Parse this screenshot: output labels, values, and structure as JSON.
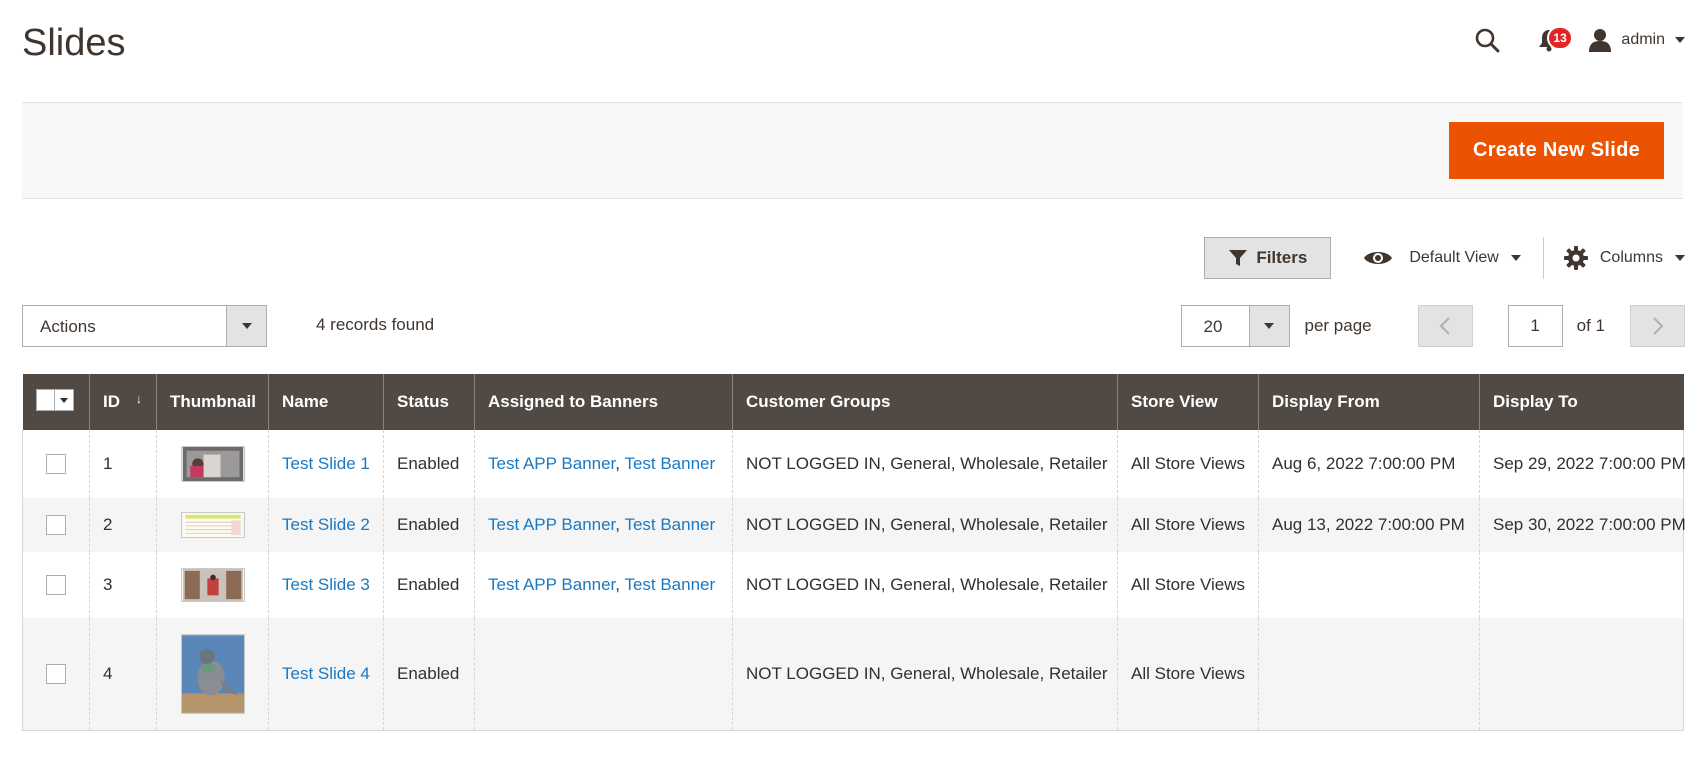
{
  "page": {
    "title": "Slides"
  },
  "header": {
    "notification_count": "13",
    "user_name": "admin"
  },
  "actions_bar": {
    "create_label": "Create New Slide"
  },
  "toolbar": {
    "filters_label": "Filters",
    "view_label": "Default View",
    "columns_label": "Columns",
    "actions_label": "Actions",
    "records_found": "4 records found",
    "per_page_value": "20",
    "per_page_label": "per page",
    "current_page": "1",
    "of_pages": "of 1"
  },
  "grid": {
    "columns": [
      "ID",
      "Thumbnail",
      "Name",
      "Status",
      "Assigned to Banners",
      "Customer Groups",
      "Store View",
      "Display From",
      "Display To"
    ],
    "rows": [
      {
        "id": "1",
        "name": "Test Slide 1",
        "status": "Enabled",
        "banner_1": "Test APP Banner",
        "sep": ",",
        "banner_2": "Test Banner",
        "groups": "NOT LOGGED IN, General, Wholesale, Retailer",
        "store_view": "All Store Views",
        "display_from": "Aug 6, 2022 7:00:00 PM",
        "display_to": "Sep 29, 2022 7:00:00 PM"
      },
      {
        "id": "2",
        "name": "Test Slide 2",
        "status": "Enabled",
        "banner_1": "Test APP Banner",
        "sep": ",",
        "banner_2": "Test Banner",
        "groups": "NOT LOGGED IN, General, Wholesale, Retailer",
        "store_view": "All Store Views",
        "display_from": "Aug 13, 2022 7:00:00 PM",
        "display_to": "Sep 30, 2022 7:00:00 PM"
      },
      {
        "id": "3",
        "name": "Test Slide 3",
        "status": "Enabled",
        "banner_1": "Test APP Banner",
        "sep": ",",
        "banner_2": "Test Banner",
        "groups": "NOT LOGGED IN, General, Wholesale, Retailer",
        "store_view": "All Store Views",
        "display_from": "",
        "display_to": ""
      },
      {
        "id": "4",
        "name": "Test Slide 4",
        "status": "Enabled",
        "banner_1": "",
        "sep": "",
        "banner_2": "",
        "groups": "NOT LOGGED IN, General, Wholesale, Retailer",
        "store_view": "All Store Views",
        "display_from": "",
        "display_to": ""
      }
    ]
  },
  "colors": {
    "accent": "#eb5202",
    "header_bg": "#514943",
    "link": "#1979c3",
    "badge": "#e22626"
  }
}
